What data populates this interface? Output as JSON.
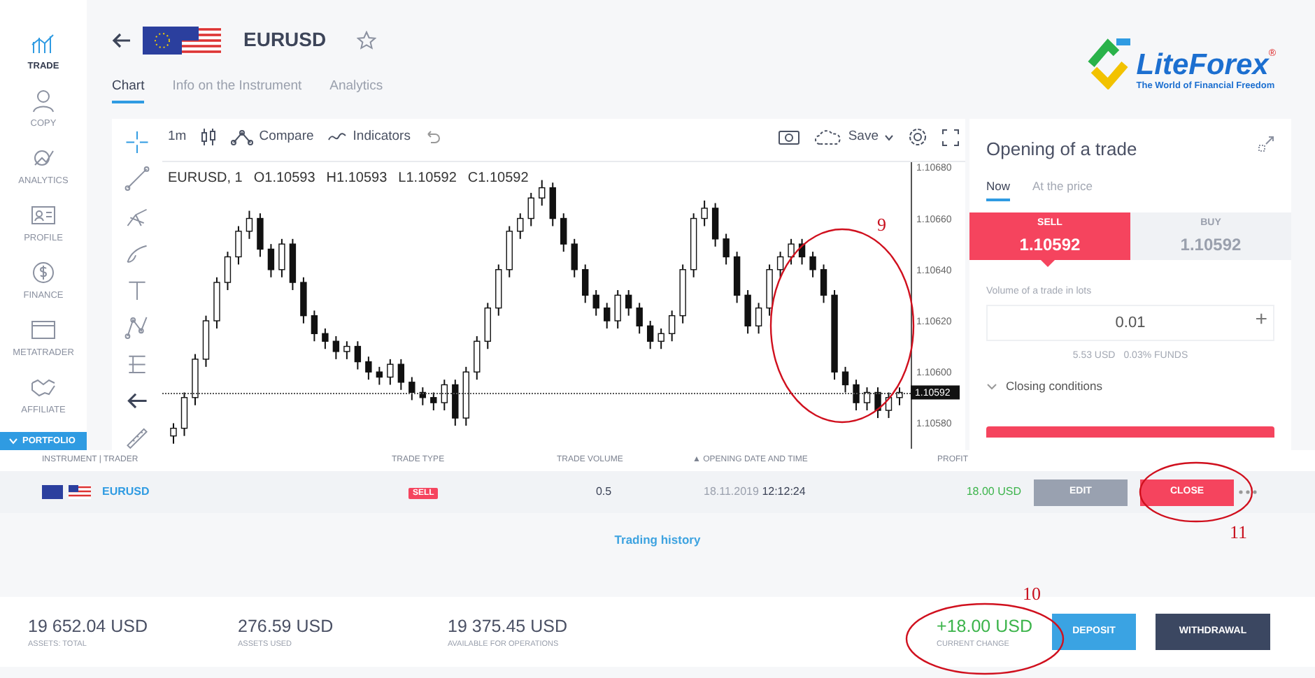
{
  "sidebar": {
    "items": [
      {
        "label": "TRADE",
        "selected": true
      },
      {
        "label": "COPY",
        "selected": false
      },
      {
        "label": "ANALYTICS",
        "selected": false
      },
      {
        "label": "PROFILE",
        "selected": false
      },
      {
        "label": "FINANCE",
        "selected": false
      },
      {
        "label": "METATRADER",
        "selected": false
      },
      {
        "label": "AFFILIATE",
        "selected": false
      }
    ],
    "portfolio": {
      "label": "PORTFOLIO",
      "expanded": true
    }
  },
  "header": {
    "symbol": "EURUSD",
    "favorite": false,
    "tabs": [
      {
        "label": "Chart",
        "selected": true
      },
      {
        "label": "Info on the Instrument",
        "selected": false
      },
      {
        "label": "Analytics",
        "selected": false
      }
    ]
  },
  "logo": {
    "name": "LiteForex",
    "tagline": "The World of Financial Freedom",
    "mark": "®"
  },
  "chart_toolbar": {
    "interval": "1m",
    "compare": "Compare",
    "indicators": "Indicators",
    "save": "Save"
  },
  "chart": {
    "current_price": "1.10592",
    "legend": {
      "symbol": "EURUSD, 1",
      "open": "O1.10593",
      "high": "H1.10593",
      "low": "L1.10592",
      "close": "C1.10592"
    },
    "chart_data": {
      "type": "candlestick",
      "ylim": [
        1.1057,
        1.10682
      ],
      "yticks": [
        {
          "value": 1.1068,
          "label": "1.10680"
        },
        {
          "value": 1.1066,
          "label": "1.10660"
        },
        {
          "value": 1.1064,
          "label": "1.10640"
        },
        {
          "value": 1.1062,
          "label": "1.10620"
        },
        {
          "value": 1.106,
          "label": "1.10600"
        },
        {
          "value": 1.1058,
          "label": "1.10580"
        }
      ],
      "ohlc": [
        [
          1.10575,
          1.1058,
          1.10572,
          1.10578
        ],
        [
          1.10578,
          1.10592,
          1.10575,
          1.1059
        ],
        [
          1.1059,
          1.10607,
          1.10587,
          1.10605
        ],
        [
          1.10605,
          1.10622,
          1.10602,
          1.1062
        ],
        [
          1.1062,
          1.10637,
          1.10617,
          1.10635
        ],
        [
          1.10635,
          1.10647,
          1.10632,
          1.10645
        ],
        [
          1.10645,
          1.10657,
          1.10642,
          1.10655
        ],
        [
          1.10655,
          1.10663,
          1.10652,
          1.1066
        ],
        [
          1.1066,
          1.10662,
          1.10645,
          1.10648
        ],
        [
          1.10648,
          1.1065,
          1.10637,
          1.1064
        ],
        [
          1.1064,
          1.10652,
          1.10637,
          1.1065
        ],
        [
          1.1065,
          1.10652,
          1.10632,
          1.10635
        ],
        [
          1.10635,
          1.10637,
          1.10619,
          1.10622
        ],
        [
          1.10622,
          1.10624,
          1.10612,
          1.10615
        ],
        [
          1.10615,
          1.10617,
          1.10609,
          1.10612
        ],
        [
          1.10612,
          1.10614,
          1.10605,
          1.10608
        ],
        [
          1.10608,
          1.10612,
          1.10605,
          1.1061
        ],
        [
          1.1061,
          1.10612,
          1.10601,
          1.10604
        ],
        [
          1.10604,
          1.10606,
          1.10597,
          1.106
        ],
        [
          1.106,
          1.10602,
          1.10595,
          1.10598
        ],
        [
          1.10598,
          1.10605,
          1.10595,
          1.10603
        ],
        [
          1.10603,
          1.10605,
          1.10593,
          1.10596
        ],
        [
          1.10596,
          1.10598,
          1.10589,
          1.10592
        ],
        [
          1.10592,
          1.10594,
          1.10587,
          1.1059
        ],
        [
          1.1059,
          1.10592,
          1.10585,
          1.10588
        ],
        [
          1.10588,
          1.10597,
          1.10585,
          1.10595
        ],
        [
          1.10595,
          1.10597,
          1.10579,
          1.10582
        ],
        [
          1.10582,
          1.10602,
          1.10579,
          1.106
        ],
        [
          1.106,
          1.10614,
          1.10597,
          1.10612
        ],
        [
          1.10612,
          1.10627,
          1.10609,
          1.10625
        ],
        [
          1.10625,
          1.10642,
          1.10622,
          1.1064
        ],
        [
          1.1064,
          1.10657,
          1.10637,
          1.10655
        ],
        [
          1.10655,
          1.10662,
          1.10652,
          1.1066
        ],
        [
          1.1066,
          1.1067,
          1.10657,
          1.10668
        ],
        [
          1.10668,
          1.10675,
          1.10665,
          1.10672
        ],
        [
          1.10672,
          1.10674,
          1.10657,
          1.1066
        ],
        [
          1.1066,
          1.10662,
          1.10647,
          1.1065
        ],
        [
          1.1065,
          1.10652,
          1.10637,
          1.1064
        ],
        [
          1.1064,
          1.10642,
          1.10627,
          1.1063
        ],
        [
          1.1063,
          1.10632,
          1.10622,
          1.10625
        ],
        [
          1.10625,
          1.10627,
          1.10617,
          1.1062
        ],
        [
          1.1062,
          1.10632,
          1.10617,
          1.1063
        ],
        [
          1.1063,
          1.10632,
          1.10622,
          1.10625
        ],
        [
          1.10625,
          1.10627,
          1.10615,
          1.10618
        ],
        [
          1.10618,
          1.1062,
          1.10609,
          1.10612
        ],
        [
          1.10612,
          1.10617,
          1.10609,
          1.10615
        ],
        [
          1.10615,
          1.10624,
          1.10612,
          1.10622
        ],
        [
          1.10622,
          1.10642,
          1.10619,
          1.1064
        ],
        [
          1.1064,
          1.10662,
          1.10637,
          1.1066
        ],
        [
          1.1066,
          1.10667,
          1.10657,
          1.10664
        ],
        [
          1.10664,
          1.10666,
          1.10649,
          1.10652
        ],
        [
          1.10652,
          1.10654,
          1.10642,
          1.10645
        ],
        [
          1.10645,
          1.10647,
          1.10627,
          1.1063
        ],
        [
          1.1063,
          1.10632,
          1.10615,
          1.10618
        ],
        [
          1.10618,
          1.10627,
          1.10615,
          1.10625
        ],
        [
          1.10625,
          1.10642,
          1.10622,
          1.1064
        ],
        [
          1.1064,
          1.10647,
          1.10637,
          1.10645
        ],
        [
          1.10645,
          1.10652,
          1.10642,
          1.1065
        ],
        [
          1.1065,
          1.10652,
          1.10642,
          1.10645
        ],
        [
          1.10645,
          1.10647,
          1.10637,
          1.1064
        ],
        [
          1.1064,
          1.10642,
          1.10627,
          1.1063
        ],
        [
          1.1063,
          1.10632,
          1.10597,
          1.106
        ],
        [
          1.106,
          1.10602,
          1.10592,
          1.10595
        ],
        [
          1.10595,
          1.10597,
          1.10585,
          1.10588
        ],
        [
          1.10588,
          1.10594,
          1.10585,
          1.10592
        ],
        [
          1.10592,
          1.10594,
          1.10582,
          1.10585
        ],
        [
          1.10585,
          1.10592,
          1.10582,
          1.1059
        ],
        [
          1.1059,
          1.10594,
          1.10587,
          1.10592
        ]
      ]
    }
  },
  "trade_panel": {
    "title": "Opening of a trade",
    "tabs": [
      {
        "label": "Now",
        "selected": true
      },
      {
        "label": "At the price",
        "selected": false
      }
    ],
    "sides": [
      {
        "label": "SELL",
        "price": "1.10592",
        "selected": true
      },
      {
        "label": "BUY",
        "price": "1.10592",
        "selected": false
      }
    ],
    "volume_label": "Volume of a trade in lots",
    "volume": "0.01",
    "plus": "+",
    "margin": "5.53 USD",
    "funds": "0.03% FUNDS",
    "closing_conditions": "Closing conditions",
    "closing_expanded": false
  },
  "positions": {
    "columns": [
      {
        "label": "INSTRUMENT | TRADER"
      },
      {
        "label": "TRADE TYPE"
      },
      {
        "label": "TRADE VOLUME"
      },
      {
        "label": "OPENING DATE AND TIME",
        "sort_indicator": "▲"
      },
      {
        "label": "PROFIT"
      }
    ],
    "rows": [
      {
        "instrument": "EURUSD",
        "type": "SELL",
        "volume": "0.5",
        "date": "18.11.2019",
        "time": "12:12:24",
        "profit": "18.00 USD",
        "actions": [
          "EDIT",
          "CLOSE"
        ]
      }
    ],
    "history_link": "Trading history"
  },
  "footer": {
    "stats": [
      {
        "value": "19 652.04 USD",
        "label": "ASSETS: TOTAL"
      },
      {
        "value": "276.59 USD",
        "label": "ASSETS USED"
      },
      {
        "value": "19 375.45 USD",
        "label": "AVAILABLE FOR OPERATIONS"
      }
    ],
    "change": {
      "value": "+18.00 USD",
      "label": "CURRENT CHANGE"
    },
    "buttons": [
      "DEPOSIT",
      "WITHDRAWAL"
    ]
  },
  "annotations": [
    {
      "label": "9"
    },
    {
      "label": "10"
    },
    {
      "label": "11"
    }
  ]
}
